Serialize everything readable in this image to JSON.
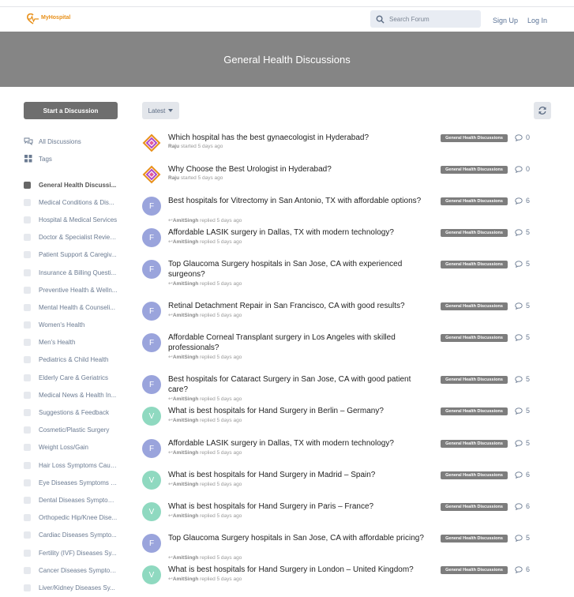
{
  "header": {
    "logo_text": "MyHospital",
    "search_placeholder": "Search Forum",
    "signup_label": "Sign Up",
    "login_label": "Log In"
  },
  "hero": {
    "title": "General Health Discussions"
  },
  "sidebar": {
    "start_label": "Start a Discussion",
    "nav": [
      {
        "label": "All Discussions",
        "icon": "chat-bubbles-icon"
      },
      {
        "label": "Tags",
        "icon": "grid-icon"
      }
    ],
    "tags": [
      "General Health Discussi...",
      "Medical Conditions & Dis...",
      "Hospital & Medical Services",
      "Doctor & Specialist Reviews",
      "Patient Support & Caregiv...",
      "Insurance & Billing Questi...",
      "Preventive Health & Welln...",
      "Mental Health & Counseli...",
      "Women's Health",
      "Men's Health",
      "Pediatrics & Child Health",
      "Elderly Care & Geriatrics",
      "Medical News & Health In...",
      "Suggestions & Feedback",
      "Cosmetic/Plastic Surgery",
      "Weight Loss/Gain",
      "Hair Loss Symptoms Caus...",
      "Eye Diseases Symptoms C...",
      "Dental Diseases Symptom...",
      "Orthopedic Hip/Knee Dise...",
      "Cardiac Diseases Sympto...",
      "Fertility (IVF) Diseases Sy...",
      "Cancer Diseases Symptom...",
      "Liver/Kidney Diseases Sy..."
    ]
  },
  "toolbar": {
    "sort_label": "Latest"
  },
  "colors": {
    "avatar_f": "#9aa4dc",
    "avatar_v": "#8fd9c0",
    "badge": "#7d7d7d",
    "hero": "#858585"
  },
  "discussions": [
    {
      "title": "Which hospital has the best gynaecologist in Hyderabad?",
      "user": "Raju",
      "action": "started",
      "time": "5 days ago",
      "tag": "General Health Discussions",
      "replies": "0",
      "avatar": ""
    },
    {
      "title": "Why Choose the Best Urologist in Hyderabad?",
      "user": "Raju",
      "action": "started",
      "time": "5 days ago",
      "tag": "General Health Discussions",
      "replies": "0",
      "avatar": ""
    },
    {
      "title": "Best hospitals for Vitrectomy in San Antonio, TX with affordable options?",
      "user": "AmitSingh",
      "action": "replied",
      "time": "5 days ago",
      "tag": "General Health Discussions",
      "replies": "6",
      "avatar": "F"
    },
    {
      "title": "Affordable LASIK surgery in Dallas, TX with modern technology?",
      "user": "AmitSingh",
      "action": "replied",
      "time": "5 days ago",
      "tag": "General Health Discussions",
      "replies": "5",
      "avatar": "F"
    },
    {
      "title": "Top Glaucoma Surgery hospitals in San Jose, CA with experienced surgeons?",
      "user": "AmitSingh",
      "action": "replied",
      "time": "5 days ago",
      "tag": "General Health Discussions",
      "replies": "5",
      "avatar": "F"
    },
    {
      "title": "Retinal Detachment Repair in San Francisco, CA with good results?",
      "user": "AmitSingh",
      "action": "replied",
      "time": "5 days ago",
      "tag": "General Health Discussions",
      "replies": "5",
      "avatar": "F"
    },
    {
      "title": "Affordable Corneal Transplant surgery in Los Angeles with skilled professionals?",
      "user": "AmitSingh",
      "action": "replied",
      "time": "5 days ago",
      "tag": "General Health Discussions",
      "replies": "5",
      "avatar": "F"
    },
    {
      "title": "Best hospitals for Cataract Surgery in San Jose, CA with good patient care?",
      "user": "AmitSingh",
      "action": "replied",
      "time": "5 days ago",
      "tag": "General Health Discussions",
      "replies": "5",
      "avatar": "F"
    },
    {
      "title": "What is best hospitals for Hand Surgery in Berlin – Germany?",
      "user": "AmitSingh",
      "action": "replied",
      "time": "5 days ago",
      "tag": "General Health Discussions",
      "replies": "5",
      "avatar": "V"
    },
    {
      "title": "Affordable LASIK surgery in Dallas, TX with modern technology?",
      "user": "AmitSingh",
      "action": "replied",
      "time": "5 days ago",
      "tag": "General Health Discussions",
      "replies": "5",
      "avatar": "F"
    },
    {
      "title": "What is best hospitals for Hand Surgery in Madrid – Spain?",
      "user": "AmitSingh",
      "action": "replied",
      "time": "5 days ago",
      "tag": "General Health Discussions",
      "replies": "6",
      "avatar": "V"
    },
    {
      "title": "What is best hospitals for Hand Surgery in Paris – France?",
      "user": "AmitSingh",
      "action": "replied",
      "time": "5 days ago",
      "tag": "General Health Discussions",
      "replies": "6",
      "avatar": "V"
    },
    {
      "title": "Top Glaucoma Surgery hospitals in San Jose, CA with affordable pricing?",
      "user": "AmitSingh",
      "action": "replied",
      "time": "5 days ago",
      "tag": "General Health Discussions",
      "replies": "5",
      "avatar": "F"
    },
    {
      "title": "What is best hospitals for Hand Surgery in London – United Kingdom?",
      "user": "AmitSingh",
      "action": "replied",
      "time": "5 days ago",
      "tag": "General Health Discussions",
      "replies": "6",
      "avatar": "V"
    }
  ]
}
